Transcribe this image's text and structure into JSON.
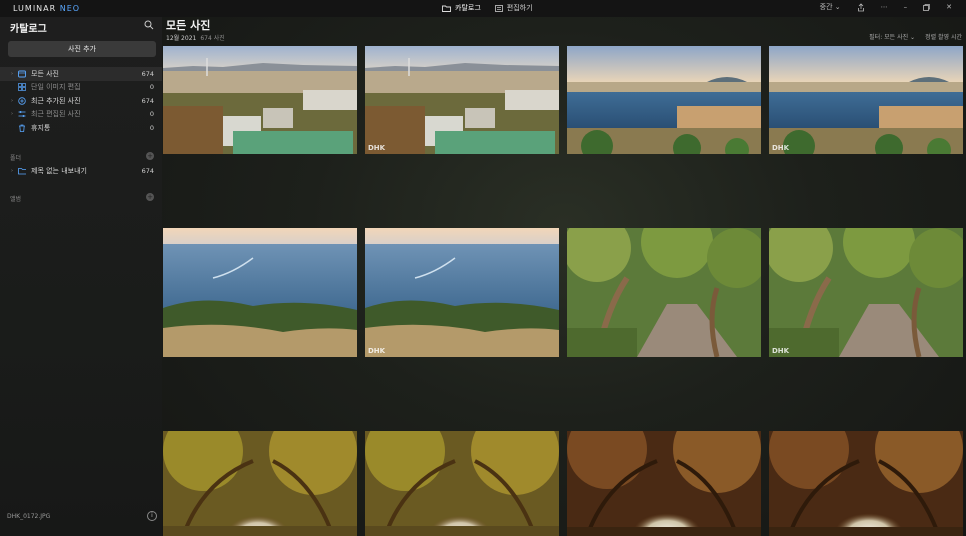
{
  "app": {
    "brand_main": "LUMINAR ",
    "brand_accent": "NEO"
  },
  "topnav": {
    "catalog": "카탈로그",
    "edit": "편집하기"
  },
  "window": {
    "view_mode": "중간 ⌄"
  },
  "sidebar": {
    "title": "카탈로그",
    "add_button": "사진 추가",
    "items": [
      {
        "label": "모든 사진",
        "count": "674"
      },
      {
        "label": "단일 이미지 편집",
        "count": "0"
      },
      {
        "label": "최근 추가된 사진",
        "count": "674"
      },
      {
        "label": "최근 편집된 사진",
        "count": "0"
      },
      {
        "label": "휴지통",
        "count": "0"
      }
    ],
    "folders_head": "폴더",
    "folders": [
      {
        "label": "제목 없는 내보내기",
        "count": "674"
      }
    ],
    "albums_head": "앨범",
    "footer_file": "DHK_0172.JPG"
  },
  "main": {
    "title": "모든 사진",
    "date": "12월 2021",
    "photo_count": "674 사진",
    "group_label": "필터: 모든 사진 ⌄",
    "sort_label": "정렬 촬영 시간"
  },
  "thumbs": {
    "watermark": "DHK"
  },
  "colors": {
    "accent": "#5aa8ff",
    "sidebar_bg": "#1e1e1e",
    "main_bg": "#1d201b"
  }
}
